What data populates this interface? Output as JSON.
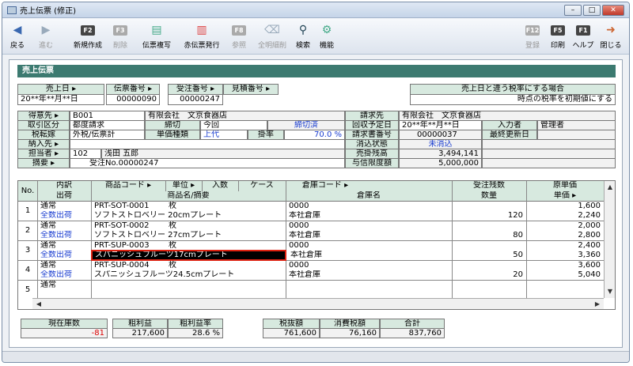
{
  "window": {
    "title": "売上伝票 (修正)"
  },
  "toolbar": [
    {
      "key": "",
      "label": "戻る",
      "icon": "back-arrow-icon",
      "enabled": true
    },
    {
      "key": "",
      "label": "進む",
      "icon": "forward-arrow-icon",
      "enabled": false
    },
    {
      "key": "F2",
      "label": "新規作成",
      "enabled": true
    },
    {
      "key": "F3",
      "label": "削除",
      "enabled": false
    },
    {
      "key": "",
      "label": "伝票複写",
      "icon": "copy-icon",
      "enabled": true
    },
    {
      "key": "",
      "label": "赤伝票発行",
      "icon": "red-slip-icon",
      "enabled": true
    },
    {
      "key": "F8",
      "label": "参照",
      "enabled": false
    },
    {
      "key": "",
      "label": "全明細削",
      "icon": "eraser-icon",
      "enabled": false
    },
    {
      "key": "",
      "label": "検索",
      "icon": "search-icon",
      "enabled": true
    },
    {
      "key": "",
      "label": "機能",
      "icon": "tools-icon",
      "enabled": true
    },
    {
      "key": "F12",
      "label": "登録",
      "enabled": false
    },
    {
      "key": "F5",
      "label": "印刷",
      "enabled": true
    },
    {
      "key": "F1",
      "label": "ヘルプ",
      "enabled": true
    },
    {
      "key": "",
      "label": "閉じる",
      "icon": "exit-icon",
      "enabled": true
    }
  ],
  "section_title": "売上伝票",
  "top": {
    "sales_date_label": "売上日",
    "sales_date": "20**年**月**日",
    "slip_no_label": "伝票番号",
    "slip_no": "00000090",
    "order_no_label": "受注番号",
    "order_no": "00000247",
    "estimate_no_label": "見積番号",
    "tax_label": "売上日と違う税率にする場合",
    "tax_value": "時点の税率を初期値にする"
  },
  "customer": {
    "customer_label": "得意先",
    "customer_code": "B001",
    "customer_name": "有限会社　文京食器店",
    "billing_label": "請求先",
    "billing_name": "有限会社　文京食器店",
    "trade_type_label": "取引区分",
    "trade_type": "都度請求",
    "cutoff_label": "締切",
    "cutoff": "今回",
    "cutoff_status": "締切済",
    "collect_date_label": "回収予定日",
    "collect_date": "20**年**月**日",
    "entry_person_label": "入力者",
    "entry_person": "管理者",
    "tax_transfer_label": "税転嫁",
    "tax_transfer": "外税/伝票計",
    "price_type_label": "単価種類",
    "price_type": "上代",
    "rate_label": "掛率",
    "rate": "70.0 %",
    "invoice_no_label": "請求書番号",
    "invoice_no": "00000037",
    "updated_label": "最終更新日",
    "delivery_label": "納入先",
    "erase_status_label": "消込状態",
    "erase_status": "未消込",
    "staff_label": "担当者",
    "staff_code": "102",
    "staff_name": "浅田 五郎",
    "receivable_label": "売掛残高",
    "receivable": "3,494,141",
    "summary_label": "摘要",
    "summary": "受注No.00000247",
    "credit_limit_label": "与信限度額",
    "credit_limit": "5,000,000"
  },
  "grid": {
    "headers": {
      "no": "No.",
      "type": "内訳",
      "ship": "出荷",
      "code": "商品コード",
      "unit": "単位",
      "qty": "入数",
      "case": "ケース",
      "name": "商品名/摘要",
      "wh_code": "倉庫コード",
      "wh_name": "倉庫名",
      "order_rem": "受注残数",
      "qty2": "数量",
      "cost": "原単価",
      "price": "単価"
    },
    "rows": [
      {
        "no": "1",
        "type": "通常",
        "ship": "全数出荷",
        "code": "PRT-SOT-0001",
        "unit": "枚",
        "name": "ソフトストロベリー 20cmプレート",
        "wh_code": "0000",
        "wh_name": "本社倉庫",
        "qty": "120",
        "cost": "1,600",
        "price": "2,240"
      },
      {
        "no": "2",
        "type": "通常",
        "ship": "全数出荷",
        "code": "PRT-SOT-0002",
        "unit": "枚",
        "name": "ソフトストロベリー 27cmプレート",
        "wh_code": "0000",
        "wh_name": "本社倉庫",
        "qty": "80",
        "cost": "2,000",
        "price": "2,800"
      },
      {
        "no": "3",
        "type": "通常",
        "ship": "全数出荷",
        "code": "PRT-SUP-0003",
        "unit": "枚",
        "name": "スパニッシュフルーツ17cmプレート",
        "wh_code": "0000",
        "wh_name": "本社倉庫",
        "qty": "50",
        "cost": "2,400",
        "price": "3,360"
      },
      {
        "no": "4",
        "type": "通常",
        "ship": "全数出荷",
        "code": "PRT-SUP-0004",
        "unit": "枚",
        "name": "スパニッシュフルーツ24.5cmプレート",
        "wh_code": "0000",
        "wh_name": "本社倉庫",
        "qty": "20",
        "cost": "3,600",
        "price": "5,040"
      },
      {
        "no": "5",
        "type": "通常",
        "ship": "",
        "code": "",
        "unit": "",
        "name": "",
        "wh_code": "",
        "wh_name": "",
        "qty": "",
        "cost": "",
        "price": ""
      }
    ]
  },
  "footer": {
    "stock_label": "現在庫数",
    "stock": "-81",
    "gross_label": "粗利益",
    "gross": "217,600",
    "gross_rate_label": "粗利益率",
    "gross_rate": "28.6 %",
    "pretax_label": "税抜額",
    "pretax": "761,600",
    "tax_label": "消費税額",
    "tax": "76,160",
    "total_label": "合計",
    "total": "837,760"
  },
  "colors": {
    "header_bg": "#d7e9df",
    "section_bg": "#3c7a70",
    "link": "#1a3dd0",
    "negative": "#dd0000"
  }
}
